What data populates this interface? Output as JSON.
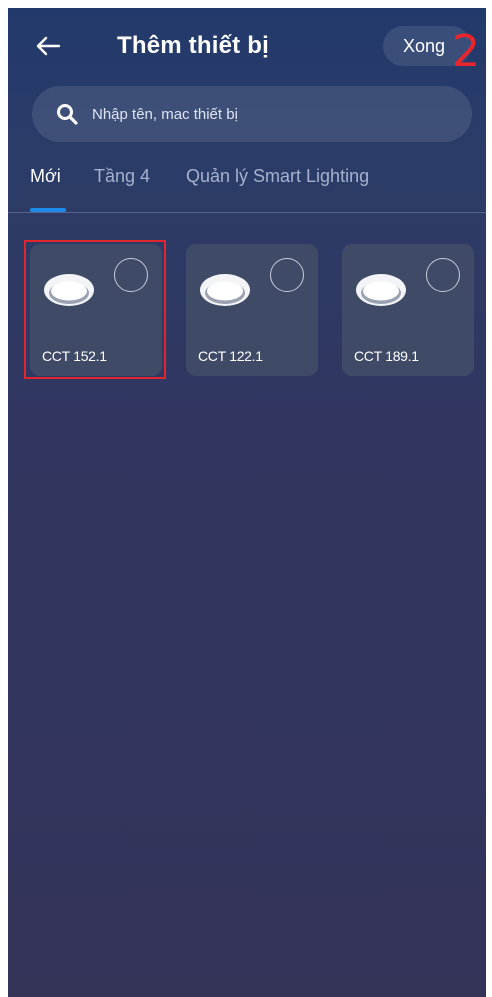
{
  "header": {
    "title": "Thêm thiết bị",
    "done_label": "Xong",
    "step_marker": "2"
  },
  "search": {
    "placeholder": "Nhập tên, mac thiết bị",
    "value": ""
  },
  "tabs": [
    {
      "label": "Mới",
      "active": true
    },
    {
      "label": "Tầng 4",
      "active": false
    },
    {
      "label": "Quản lý Smart Lighting",
      "active": false
    }
  ],
  "devices": [
    {
      "name": "CCT 152.1",
      "icon": "ceiling-light-icon",
      "selected": false
    },
    {
      "name": "CCT 122.1",
      "icon": "ceiling-light-icon",
      "selected": false
    },
    {
      "name": "CCT 189.1",
      "icon": "ceiling-light-icon",
      "selected": false
    }
  ],
  "colors": {
    "background_top": "#223a6b",
    "background_bottom": "#343459",
    "accent": "#1e8bea",
    "highlight": "#e0262c"
  }
}
